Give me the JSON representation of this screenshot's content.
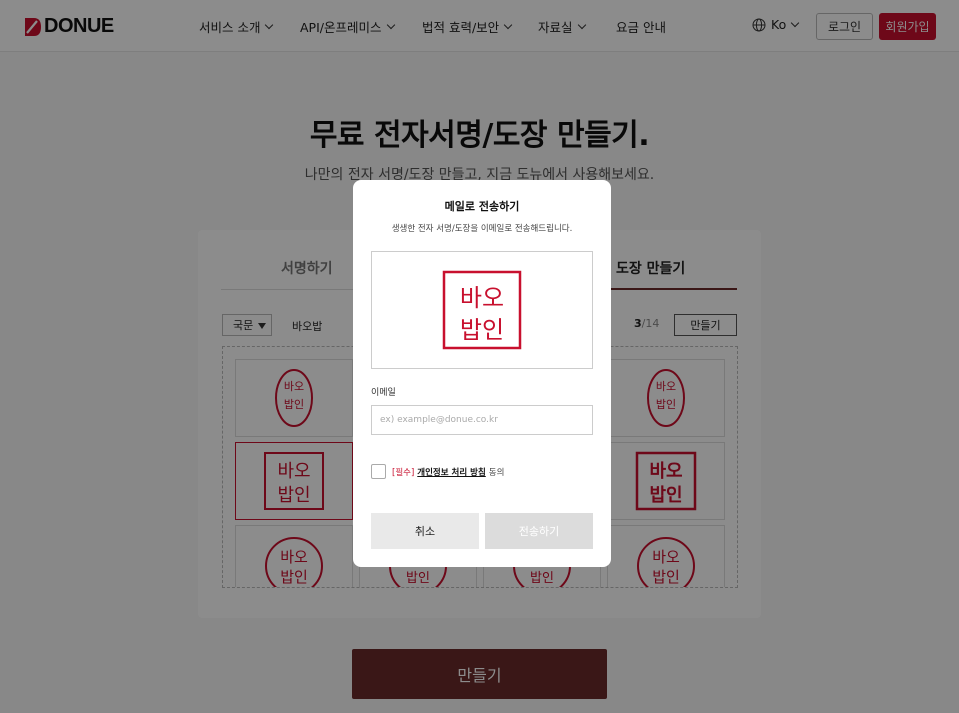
{
  "header": {
    "logo_text": "DONUE",
    "nav": [
      "서비스 소개",
      "API/온프레미스",
      "법적 효력/보안",
      "자료실",
      "요금 안내"
    ],
    "lang": "Ko",
    "login": "로그인",
    "signup": "회원가입"
  },
  "hero": {
    "title": "무료 전자서명/도장 만들기.",
    "subtitle": "나만의 전자 서명/도장 만들고, 지금 도뉴에서 사용해보세요."
  },
  "tabs": [
    "서명하기",
    "도장 만들기"
  ],
  "controls": {
    "script_select": "국문",
    "name_value": "바오밥",
    "pager_current": "3",
    "pager_total": "/14",
    "make_button": "만들기"
  },
  "make_button": "만들기",
  "stamp_text": [
    "바오",
    "밥인"
  ],
  "modal": {
    "title": "메일로 전송하기",
    "description": "생생한 전자 서명/도장을 이메일로 전송해드립니다.",
    "email_label": "이메일",
    "email_placeholder": "ex) example@donue.co.kr",
    "agree_required": "[필수]",
    "agree_policy": "개인정보 처리 방침",
    "agree_suffix": "동의",
    "cancel": "취소",
    "send": "전송하기"
  },
  "colors": {
    "brand_red": "#c8102e",
    "dark_maroon": "#6b2a2a",
    "stamp_red": "#c8102e"
  }
}
